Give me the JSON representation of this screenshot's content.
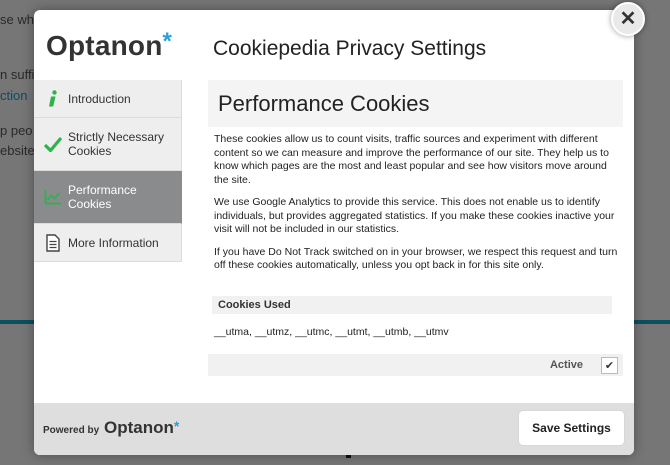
{
  "background": {
    "fragments": [
      "se wh",
      "n suffi",
      "ction",
      "p peo",
      "ebsite"
    ]
  },
  "modal": {
    "brand": {
      "name_a": "Opt",
      "name_b": "anon",
      "star": "*"
    },
    "title": "Cookiepedia Privacy Settings",
    "close_glyph": "✕",
    "sidebar": {
      "items": [
        {
          "label": "Introduction",
          "icon": "info-icon",
          "icon_glyph": "i"
        },
        {
          "label": "Strictly Necessary Cookies",
          "icon": "checkmark-icon",
          "icon_glyph": "✔"
        },
        {
          "label": "Performance Cookies",
          "icon": "chart-icon",
          "icon_glyph": ""
        },
        {
          "label": "More Information",
          "icon": "document-icon",
          "icon_glyph": ""
        }
      ]
    },
    "section": {
      "title": "Performance Cookies",
      "paragraphs": [
        "These cookies allow us to count visits, traffic sources and experiment with different content so we can measure and improve the performance of our site. They help us to know which pages are the most and least popular and see how visitors move around the site.",
        "We use Google Analytics to provide this service. This does not enable us to identify individuals, but provides aggregated statistics. If you make these cookies inactive your visit will not be included in our statistics.",
        "If you have Do Not Track switched on in your browser, we respect this request and turn off these cookies automatically, unless you opt back in for this site only."
      ],
      "cookies_used_label": "Cookies Used",
      "cookies_used": "__utma, __utmz, __utmc, __utmt, __utmb, __utmv",
      "active_label": "Active",
      "active_check": "✔"
    },
    "footer": {
      "powered_by": "Powered by",
      "logo_a": "Opt",
      "logo_b": "anon",
      "star": "*",
      "save_label": "Save Settings"
    }
  },
  "colors": {
    "accent_green": "#2db34a",
    "brand_blue": "#2aa0d8",
    "active_nav": "#8a8b8d"
  }
}
